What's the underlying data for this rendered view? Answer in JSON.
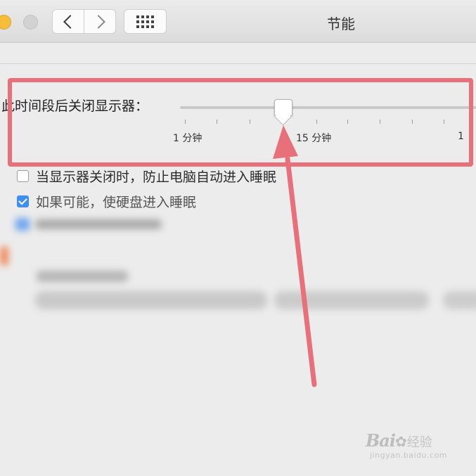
{
  "window": {
    "title": "节能"
  },
  "display_sleep": {
    "label": "此时间段后关闭显示器：",
    "tick_labels": [
      "1 分钟",
      "15 分钟",
      "1"
    ],
    "slider_value_minutes": 15
  },
  "options": [
    {
      "label": "当显示器关闭时，防止电脑自动进入睡眠",
      "checked": false
    },
    {
      "label": "如果可能，使硬盘进入睡眠",
      "checked": true
    }
  ],
  "watermark": {
    "brand": "Bai",
    "brand2": "经验",
    "url": "jingyan.baidu.com"
  },
  "icons": {
    "back": "chevron-left-icon",
    "forward": "chevron-right-icon",
    "grid": "grid-icon",
    "paw": "baidu-paw-icon"
  },
  "colors": {
    "highlight": "#e8707a",
    "checkbox_on": "#3f8ef3"
  }
}
